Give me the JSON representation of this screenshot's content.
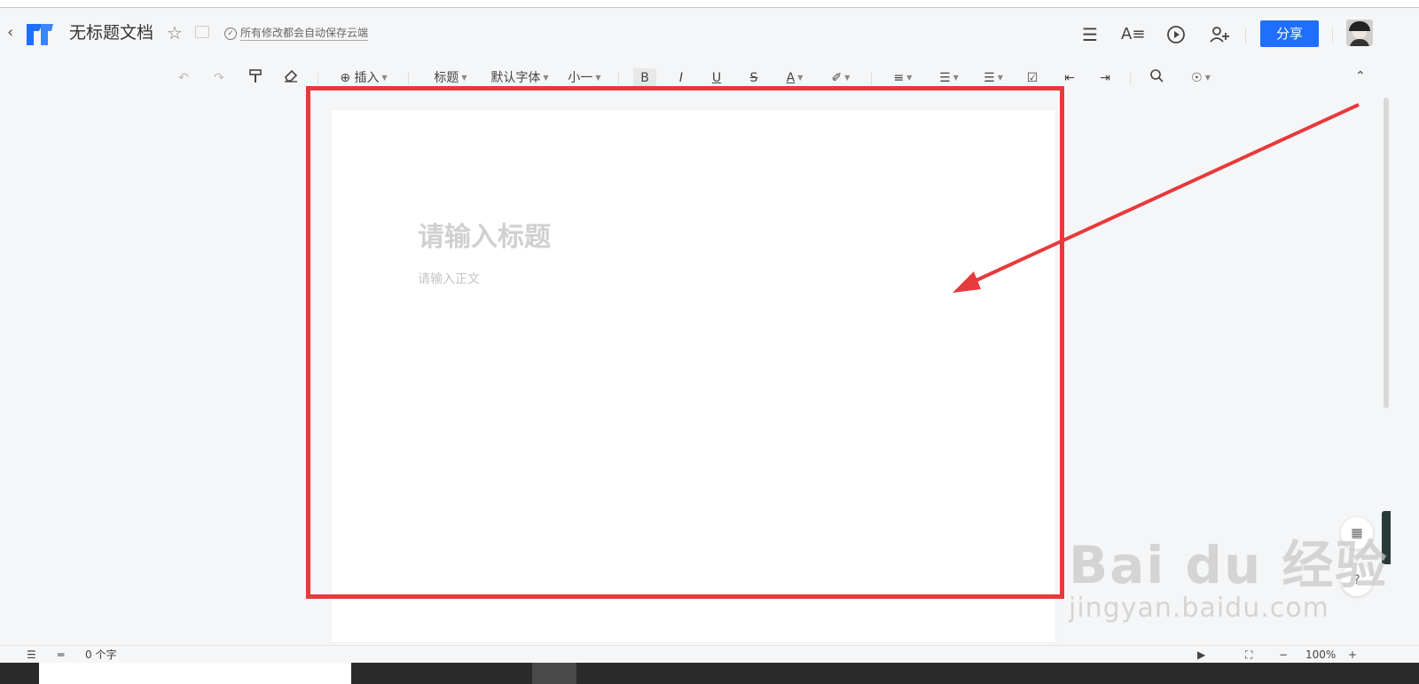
{
  "header": {
    "doc_title": "无标题文档",
    "save_status": "所有修改都会自动保存云端",
    "share_label": "分享",
    "brand_color": "#1e6fff"
  },
  "toolbar": {
    "insert": "插入",
    "heading": "标题",
    "font": "默认字体",
    "font_size": "小一",
    "bold": "B",
    "italic": "I",
    "underline": "U",
    "strikethrough": "S",
    "font_color": "A"
  },
  "editor": {
    "title_placeholder": "请输入标题",
    "body_placeholder": "请输入正文"
  },
  "statusbar": {
    "word_count": "0 个字",
    "zoom": "100%"
  },
  "watermark": {
    "brand": "Bai du 经验",
    "url": "jingyan.baidu.com"
  },
  "side": {
    "help": "?"
  },
  "annotation": {
    "color": "#e8393c"
  }
}
